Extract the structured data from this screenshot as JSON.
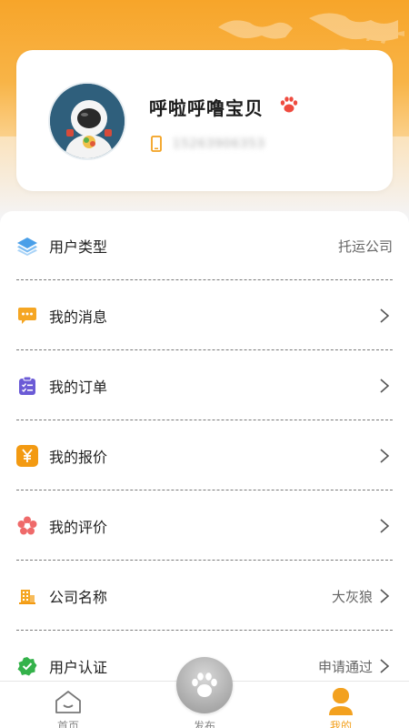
{
  "profile": {
    "name": "呼啦呼噜宝贝",
    "phone": "15263906353"
  },
  "menu": [
    {
      "label": "用户类型",
      "value": "托运公司",
      "icon": "layers-icon",
      "color": "#4a9fe8",
      "arrow": false
    },
    {
      "label": "我的消息",
      "value": "",
      "icon": "message-icon",
      "color": "#f5a623",
      "arrow": true
    },
    {
      "label": "我的订单",
      "value": "",
      "icon": "clipboard-icon",
      "color": "#6b5bd6",
      "arrow": true
    },
    {
      "label": "我的报价",
      "value": "",
      "icon": "yen-icon",
      "color": "#f39a12",
      "arrow": true
    },
    {
      "label": "我的评价",
      "value": "",
      "icon": "flower-icon",
      "color": "#ef6a6a",
      "arrow": true
    },
    {
      "label": "公司名称",
      "value": "大灰狼",
      "icon": "building-icon",
      "color": "#f5a623",
      "arrow": true
    },
    {
      "label": "用户认证",
      "value": "申请通过",
      "icon": "verified-icon",
      "color": "#34b24a",
      "arrow": true
    }
  ],
  "tabs": {
    "home": "首页",
    "publish": "发布",
    "mine": "我的"
  },
  "colors": {
    "accent": "#f3a11f",
    "header": "#f7a52a"
  }
}
